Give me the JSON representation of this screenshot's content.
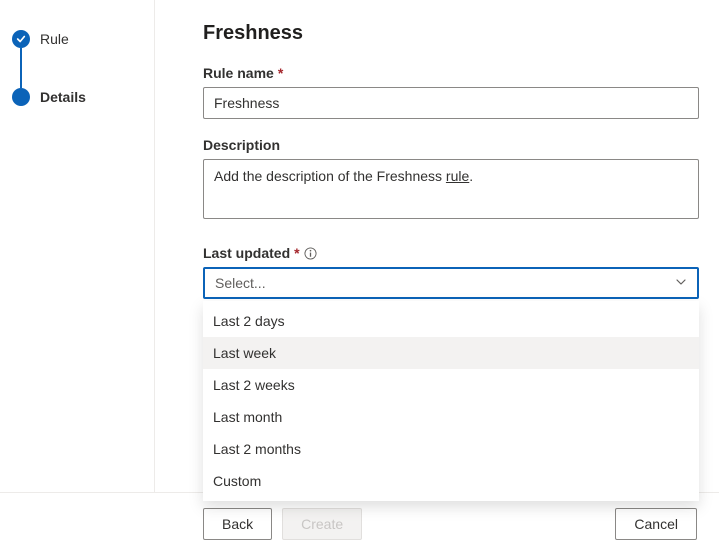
{
  "steps": {
    "rule": "Rule",
    "details": "Details"
  },
  "page": {
    "title": "Freshness"
  },
  "fields": {
    "rule_name_label": "Rule name",
    "rule_name_value": "Freshness",
    "description_label": "Description",
    "description_prefix": "Add the description of the Freshness ",
    "description_underlined": "rule",
    "description_suffix": ".",
    "last_updated_label": "Last updated",
    "select_placeholder": "Select..."
  },
  "dropdown": {
    "items": [
      "Last 2 days",
      "Last week",
      "Last 2 weeks",
      "Last month",
      "Last 2 months",
      "Custom"
    ],
    "hover_index": 1
  },
  "footer": {
    "back": "Back",
    "create": "Create",
    "cancel": "Cancel"
  }
}
